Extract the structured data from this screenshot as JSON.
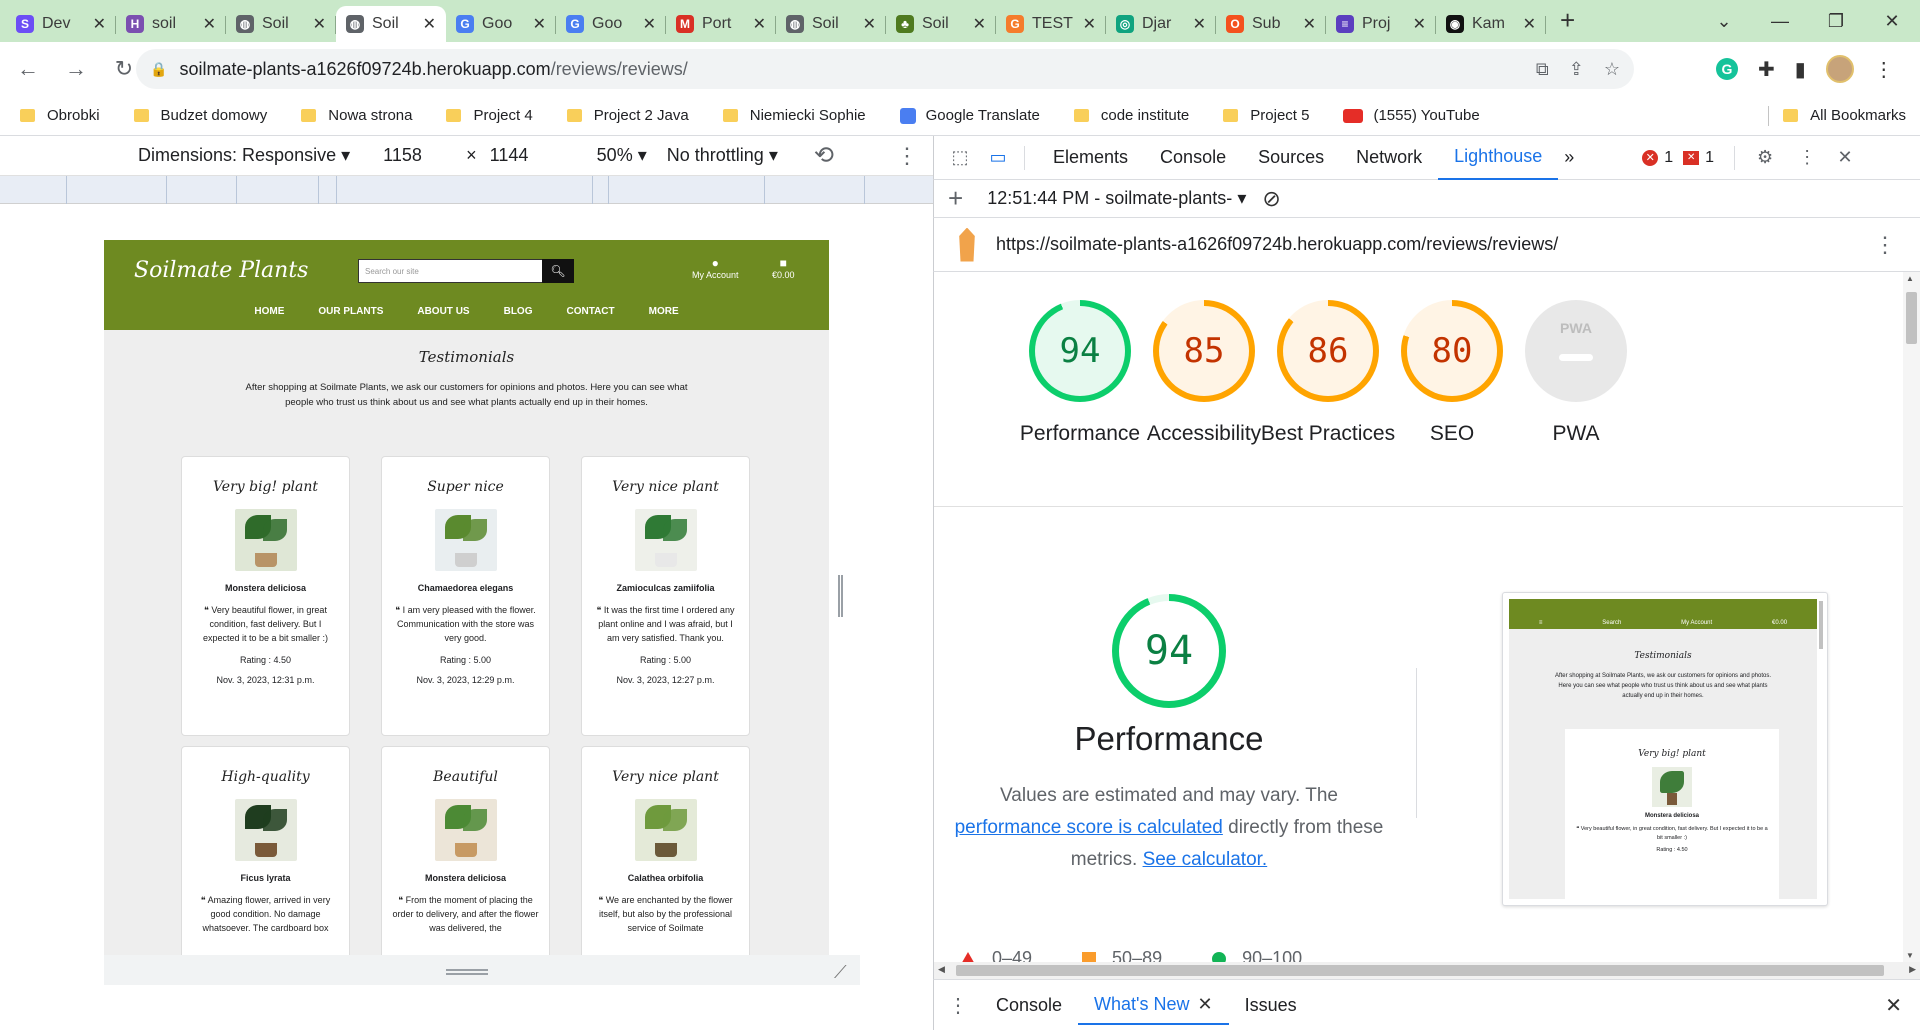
{
  "browser": {
    "tabs": [
      {
        "label": "Dev",
        "fav": "S",
        "color": "#6c4ef5",
        "active": false
      },
      {
        "label": "soil",
        "fav": "H",
        "color": "#7b4fb0",
        "active": false
      },
      {
        "label": "Soil",
        "fav": "◍",
        "color": "#5f6368",
        "active": false
      },
      {
        "label": "Soil",
        "fav": "◍",
        "color": "#5f6368",
        "active": true
      },
      {
        "label": "Goo",
        "fav": "G",
        "color": "#4a7ef1",
        "active": false
      },
      {
        "label": "Goo",
        "fav": "G",
        "color": "#4a7ef1",
        "active": false
      },
      {
        "label": "Port",
        "fav": "M",
        "color": "#d93025",
        "active": false
      },
      {
        "label": "Soil",
        "fav": "◍",
        "color": "#5f6368",
        "active": false
      },
      {
        "label": "Soil",
        "fav": "♣",
        "color": "#4f7a1f",
        "active": false
      },
      {
        "label": "TEST",
        "fav": "G",
        "color": "#f57c2c",
        "active": false
      },
      {
        "label": "Djar",
        "fav": "◎",
        "color": "#10a37f",
        "active": false
      },
      {
        "label": "Sub",
        "fav": "O",
        "color": "#f4511e",
        "active": false
      },
      {
        "label": "Proj",
        "fav": "≡",
        "color": "#5b3fbf",
        "active": false
      },
      {
        "label": "Kam",
        "fav": "◉",
        "color": "#111111",
        "active": false
      }
    ],
    "new_tab": "+",
    "url_host": "soilmate-plants-a1626f09724b.herokuapp.com",
    "url_path": "/reviews/reviews/",
    "grammarly": "G",
    "bookmarks": [
      {
        "label": "Obrobki",
        "type": "folder"
      },
      {
        "label": "Budzet domowy",
        "type": "folder"
      },
      {
        "label": "Nowa strona",
        "type": "folder"
      },
      {
        "label": "Project 4",
        "type": "folder"
      },
      {
        "label": "Project 2 Java",
        "type": "folder"
      },
      {
        "label": "Niemiecki Sophie",
        "type": "folder"
      },
      {
        "label": "Google Translate",
        "type": "google"
      },
      {
        "label": "code institute",
        "type": "folder"
      },
      {
        "label": "Project 5",
        "type": "folder"
      },
      {
        "label": "(1555) YouTube",
        "type": "youtube"
      }
    ],
    "all_bookmarks": "All Bookmarks"
  },
  "device_toolbar": {
    "dimensions_label": "Dimensions: Responsive",
    "width": "1158",
    "times": "×",
    "height": "1144",
    "zoom": "50%",
    "throttling": "No throttling"
  },
  "site": {
    "logo": "Soilmate Plants",
    "search_placeholder": "Search our site",
    "account_label": "My Account",
    "bag_label": "€0.00",
    "nav": [
      "HOME",
      "OUR PLANTS",
      "ABOUT US",
      "BLOG",
      "CONTACT",
      "MORE"
    ],
    "title": "Testimonials",
    "intro": "After shopping at Soilmate Plants, we ask our customers for opinions and photos. Here you can see what people who trust us think about us and see what plants actually end up in their homes.",
    "reviews": [
      {
        "title": "Very big! plant",
        "plant": "Monstera deliciosa",
        "text": "❝ Very beautiful flower, in great condition, fast delivery. But I expected it to be a bit smaller :)",
        "rating": "Rating : 4.50",
        "date": "Nov. 3, 2023, 12:31 p.m."
      },
      {
        "title": "Super nice",
        "plant": "Chamaedorea elegans",
        "text": "❝ I am very pleased with the flower. Communication with the store was very good.",
        "rating": "Rating : 5.00",
        "date": "Nov. 3, 2023, 12:29 p.m."
      },
      {
        "title": "Very nice plant",
        "plant": "Zamioculcas zamiifolia",
        "text": "❝ It was the first time I ordered any plant online and I was afraid, but I am very satisfied. Thank you.",
        "rating": "Rating : 5.00",
        "date": "Nov. 3, 2023, 12:27 p.m."
      },
      {
        "title": "High-quality",
        "plant": "Ficus lyrata",
        "text": "❝ Amazing flower, arrived in very good condition. No damage whatsoever. The cardboard box",
        "rating": "",
        "date": ""
      },
      {
        "title": "Beautiful",
        "plant": "Monstera deliciosa",
        "text": "❝ From the moment of placing the order to delivery, and after the flower was delivered, the",
        "rating": "",
        "date": ""
      },
      {
        "title": "Very nice plant",
        "plant": "Calathea orbifolia",
        "text": "❝ We are enchanted by the flower itself, but also by the professional service of Soilmate",
        "rating": "",
        "date": ""
      }
    ]
  },
  "devtools": {
    "tabs": [
      "Elements",
      "Console",
      "Sources",
      "Network",
      "Lighthouse"
    ],
    "active_tab": "Lighthouse",
    "more_tabs": "»",
    "errors": "1",
    "issues": "1",
    "report_time": "12:51:44 PM - soilmate-plants-",
    "report_url": "https://soilmate-plants-a1626f09724b.herokuapp.com/reviews/reviews/",
    "scores": [
      {
        "label": "Performance",
        "value": "94",
        "color": "#0cce6b",
        "text_color": "#0b8043",
        "bg": "#e6f9ef"
      },
      {
        "label": "Accessibility",
        "value": "85",
        "color": "#ffa400",
        "text_color": "#c33300",
        "bg": "#fff4e5"
      },
      {
        "label": "Best Practices",
        "value": "86",
        "color": "#ffa400",
        "text_color": "#c33300",
        "bg": "#fff4e5"
      },
      {
        "label": "SEO",
        "value": "80",
        "color": "#ffa400",
        "text_color": "#c33300",
        "bg": "#fff4e5"
      }
    ],
    "pwa_label": "PWA",
    "pwa_badge": "PWA",
    "performance_value": "94",
    "performance_title": "Performance",
    "perf_desc_1": "Values are estimated and may vary. The",
    "perf_link_1": "performance score is calculated",
    "perf_desc_2": "directly from these metrics.",
    "perf_link_2": "See calculator.",
    "legend": [
      {
        "label": "0–49",
        "shape": "triangle"
      },
      {
        "label": "50–89",
        "shape": "square"
      },
      {
        "label": "90–100",
        "shape": "circle"
      }
    ],
    "thumb": {
      "nav": [
        "Search",
        "My Account",
        "€0.00"
      ],
      "title": "Testimonials",
      "intro": "After shopping at Soilmate Plants, we ask our customers for opinions and photos. Here you can see what people who trust us think about us and see what plants actually end up in their homes.",
      "card_title": "Very big! plant",
      "card_plant": "Monstera deliciosa",
      "card_text": "❝ Very beautiful flower, in great condition, fast delivery. But I expected it to be a bit smaller :)",
      "card_rating": "Rating : 4.50"
    },
    "drawer_tabs": [
      "Console",
      "What's New",
      "Issues"
    ],
    "drawer_active": "What's New"
  }
}
